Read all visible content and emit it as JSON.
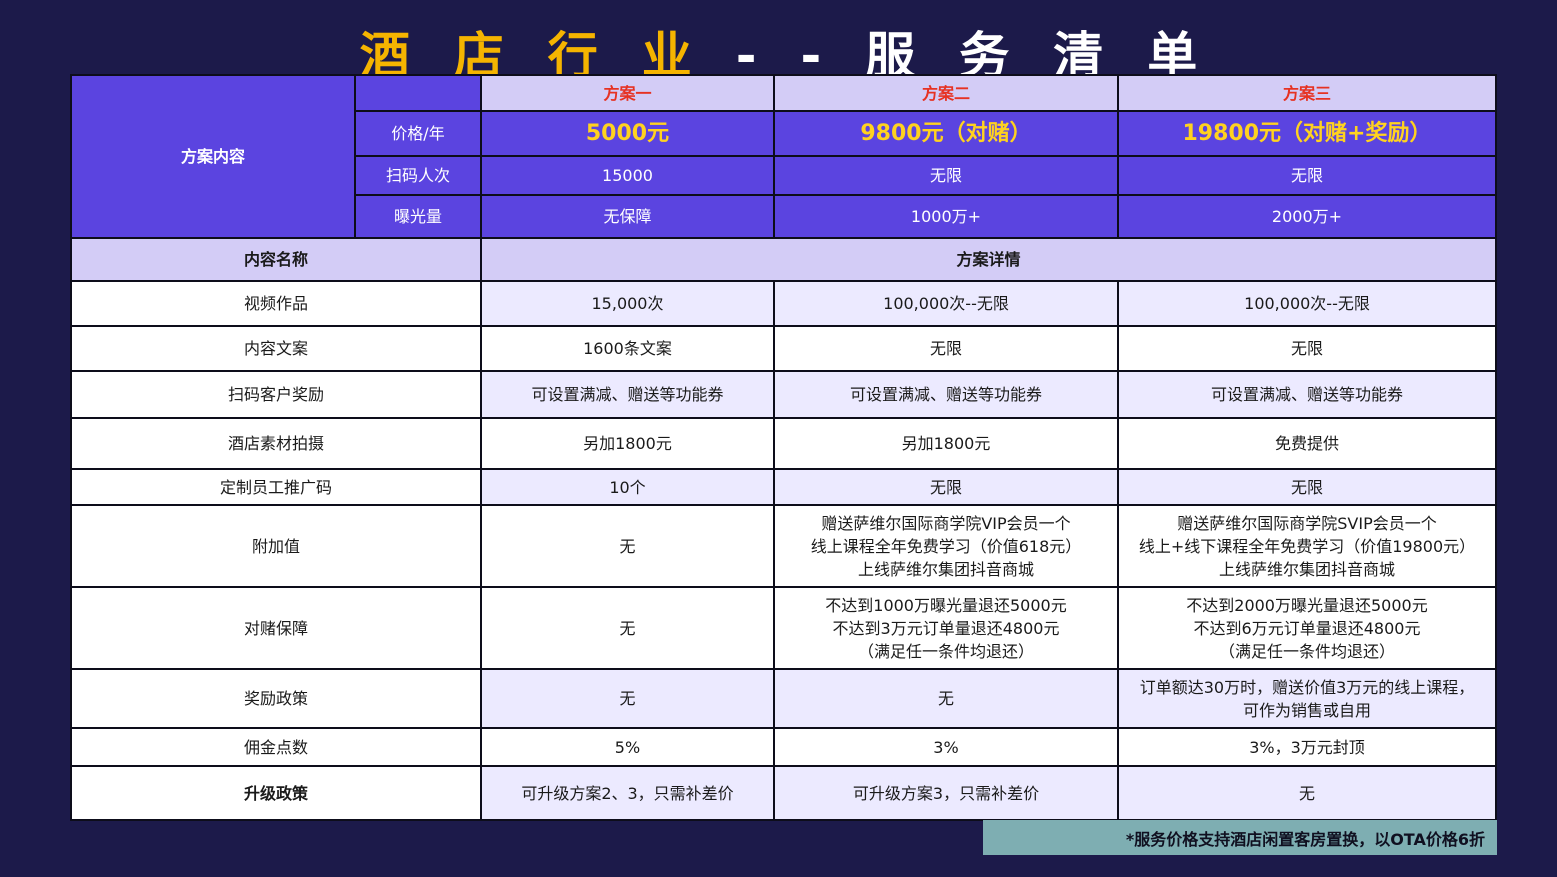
{
  "title": {
    "chars": [
      "酒",
      "店",
      "行",
      "业",
      "-",
      "-",
      "服",
      "务",
      "清",
      "单"
    ]
  },
  "header": {
    "plan_content_label": "方案内容",
    "plans": [
      "方案一",
      "方案二",
      "方案三"
    ],
    "price_label": "价格/年",
    "prices": [
      "5000元",
      "9800元（对赌）",
      "19800元（对赌+奖励）"
    ],
    "scans_label": "扫码人次",
    "scans": [
      "15000",
      "无限",
      "无限"
    ],
    "exposure_label": "曝光量",
    "exposure": [
      "无保障",
      "1000万+",
      "2000万+"
    ]
  },
  "section": {
    "content_name": "内容名称",
    "plan_details": "方案详情"
  },
  "rows": [
    {
      "name": "视频作品",
      "values": [
        "15,000次",
        "100,000次--无限",
        "100,000次--无限"
      ]
    },
    {
      "name": "内容文案",
      "values": [
        "1600条文案",
        "无限",
        "无限"
      ]
    },
    {
      "name": "扫码客户奖励",
      "values": [
        "可设置满减、赠送等功能券",
        "可设置满减、赠送等功能券",
        "可设置满减、赠送等功能券"
      ]
    },
    {
      "name": "酒店素材拍摄",
      "values": [
        "另加1800元",
        "另加1800元",
        "免费提供"
      ]
    },
    {
      "name": "定制员工推广码",
      "values": [
        "10个",
        "无限",
        "无限"
      ]
    },
    {
      "name": "附加值",
      "values": [
        [
          "无"
        ],
        [
          "赠送萨维尔国际商学院VIP会员一个",
          "线上课程全年免费学习（价值618元）",
          "上线萨维尔集团抖音商城"
        ],
        [
          "赠送萨维尔国际商学院SVIP会员一个",
          "线上+线下课程全年免费学习（价值19800元）",
          "上线萨维尔集团抖音商城"
        ]
      ]
    },
    {
      "name": "对赌保障",
      "values": [
        [
          "无"
        ],
        [
          "不达到1000万曝光量退还5000元",
          "不达到3万元订单量退还4800元",
          "（满足任一条件均退还）"
        ],
        [
          "不达到2000万曝光量退还5000元",
          "不达到6万元订单量退还4800元",
          "（满足任一条件均退还）"
        ]
      ]
    },
    {
      "name": "奖励政策",
      "values": [
        [
          "无"
        ],
        [
          "无"
        ],
        [
          "订单额达30万时，赠送价值3万元的线上课程，",
          "可作为销售或自用"
        ]
      ]
    },
    {
      "name": "佣金点数",
      "values": [
        "5%",
        "3%",
        "3%，3万元封顶"
      ]
    },
    {
      "name": "升级政策",
      "values": [
        "可升级方案2、3，只需补差价",
        "可升级方案3，只需补差价",
        "无"
      ]
    }
  ],
  "footnote": "*服务价格支持酒店闲置客房置换，以OTA价格6折"
}
